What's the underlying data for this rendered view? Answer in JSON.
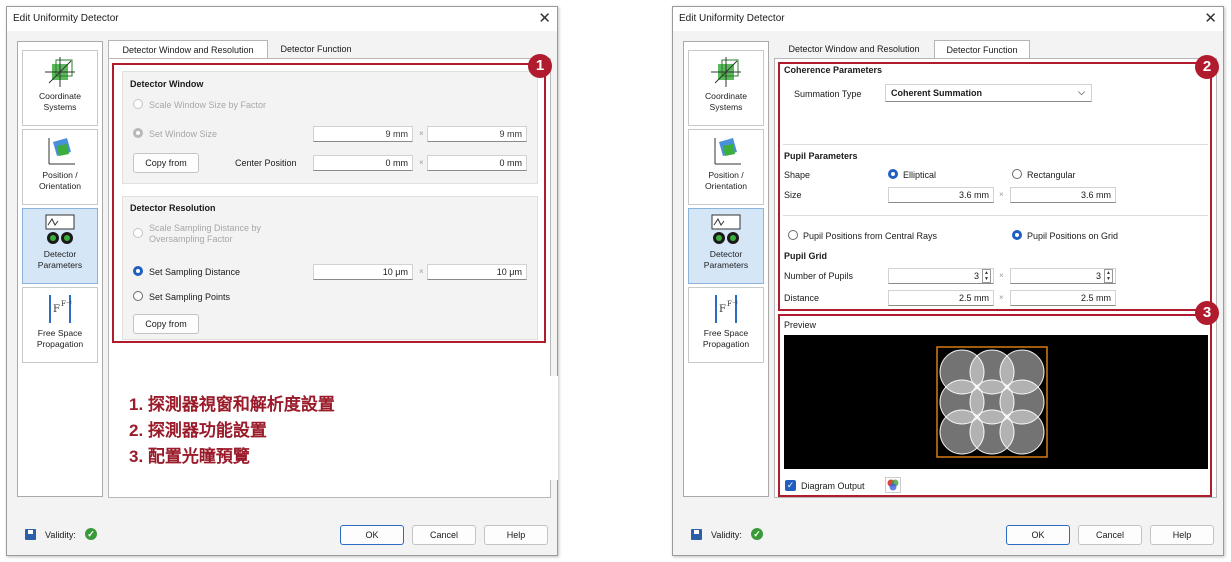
{
  "dialog_title": "Edit Uniformity Detector",
  "close_glyph": "✕",
  "sidebar": {
    "items": [
      {
        "label1": "Coordinate",
        "label2": "Systems",
        "icon": "coordinate-systems-icon"
      },
      {
        "label1": "Position /",
        "label2": "Orientation",
        "icon": "position-orientation-icon"
      },
      {
        "label1": "Detector",
        "label2": "Parameters",
        "icon": "detector-parameters-icon"
      },
      {
        "label1": "Free Space",
        "label2": "Propagation",
        "icon": "free-space-propagation-icon"
      }
    ]
  },
  "tabs": {
    "window": "Detector Window and Resolution",
    "function": "Detector Function"
  },
  "left": {
    "detector_window": {
      "title": "Detector Window",
      "scale_factor": "Scale Window Size by Factor",
      "set_size": "Set Window Size",
      "size_x": "9 mm",
      "size_y": "9 mm",
      "copy_from": "Copy from",
      "center_label": "Center Position",
      "center_x": "0 mm",
      "center_y": "0 mm"
    },
    "detector_resolution": {
      "title": "Detector Resolution",
      "scale_line1": "Scale Sampling Distance by",
      "scale_line2": "Oversampling Factor",
      "set_distance": "Set Sampling Distance",
      "dist_x": "10 μm",
      "dist_y": "10 μm",
      "set_points": "Set Sampling Points",
      "copy_from": "Copy from"
    },
    "times": "×",
    "badge": "1",
    "legend": [
      "1. 探測器視窗和解析度設置",
      "2. 探測器功能設置",
      "3. 配置光瞳預覽"
    ]
  },
  "right": {
    "coherence": {
      "title": "Coherence Parameters",
      "summation_label": "Summation Type",
      "summation_value": "Coherent Summation"
    },
    "pupil": {
      "title": "Pupil Parameters",
      "shape_label": "Shape",
      "elliptical": "Elliptical",
      "rectangular": "Rectangular",
      "size_label": "Size",
      "size_x": "3.6 mm",
      "size_y": "3.6 mm",
      "from_rays": "Pupil Positions from Central Rays",
      "on_grid": "Pupil Positions on Grid",
      "grid_title": "Pupil Grid",
      "num_label": "Number of Pupils",
      "num_x": "3",
      "num_y": "3",
      "dist_label": "Distance",
      "dist_x": "2.5 mm",
      "dist_y": "2.5 mm"
    },
    "preview": {
      "title": "Preview",
      "diagram_output": "Diagram Output"
    },
    "badge2": "2",
    "badge3": "3",
    "times": "×"
  },
  "footer": {
    "validity": "Validity:",
    "ok": "OK",
    "cancel": "Cancel",
    "help": "Help"
  },
  "colors": {
    "accent_red": "#b01c2e",
    "accent_blue": "#1f5fbf",
    "preview_orange": "#d87a16"
  }
}
